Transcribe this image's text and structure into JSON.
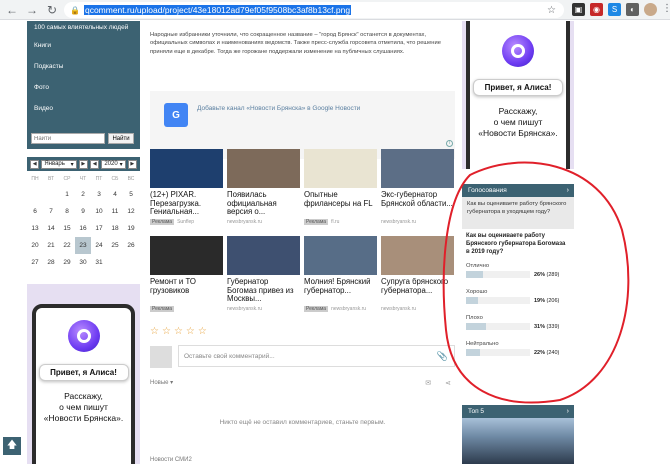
{
  "browser": {
    "url": "qcomment.ru/upload/project/43e18012ad79ef05f9508bc3af8b13cf.png"
  },
  "sidebar": {
    "items": [
      {
        "label": "100 самых влиятельных людей"
      },
      {
        "label": "Книги"
      },
      {
        "label": "Подкасты"
      },
      {
        "label": "Фото"
      },
      {
        "label": "Видео"
      }
    ],
    "search_placeholder": "Найти",
    "search_button": "Найти"
  },
  "calendar": {
    "month": "Январь",
    "year": "2020",
    "days_of_week": [
      "ПН",
      "ВТ",
      "СР",
      "ЧТ",
      "ПТ",
      "СБ",
      "ВС"
    ],
    "today": "23",
    "days": [
      "",
      "",
      "1",
      "2",
      "3",
      "4",
      "5",
      "6",
      "7",
      "8",
      "9",
      "10",
      "11",
      "12",
      "13",
      "14",
      "15",
      "16",
      "17",
      "18",
      "19",
      "20",
      "21",
      "22",
      "23",
      "24",
      "25",
      "26",
      "27",
      "28",
      "29",
      "30",
      "31",
      "",
      ""
    ]
  },
  "alice_ad": {
    "bubble": "Привет, я Алиса!",
    "text_line1": "Расскажу,",
    "text_line2": "о чем пишут",
    "text_line3": "«Новости Брянска»."
  },
  "article": {
    "text": "Народные избранники уточнили, что сокращенное название – \"город Брянск\" останется в документах, официальных символах и наименованиях ведомств. Также пресс-служба горсовета отметила, что решение приняли еще в декабре. Тогда же горожане поддержали изменение на публичных слушаниях."
  },
  "google_news": {
    "logo": "G",
    "text": "Добавьте канал «Новости Брянска» в Google Новости"
  },
  "ads": [
    {
      "title": "(12+) PIXAR. Перезагрузка. Гениальная...",
      "source": "Sunflep",
      "tag": "Реклама",
      "color": "#1e3f6e"
    },
    {
      "title": "Появилась официальная версия о...",
      "source": "newsbryansk.ru",
      "tag": "",
      "color": "#7d6a5a"
    },
    {
      "title": "Опытные фрилансеры на FL",
      "source": "fl.ru",
      "tag": "Реклама",
      "color": "#e9e4d2"
    },
    {
      "title": "Экс-губернатор Брянской области...",
      "source": "newsbryansk.ru",
      "tag": "",
      "color": "#5c6e86"
    },
    {
      "title": "Ремонт и ТО грузовиков",
      "source": "",
      "tag": "Реклама",
      "color": "#2a2a2a"
    },
    {
      "title": "Губернатор Богомаз привез из Москвы...",
      "source": "newsbryansk.ru",
      "tag": "",
      "color": "#3e5070"
    },
    {
      "title": "Молния! Брянский губернатор...",
      "source": "newsbryansk.ru",
      "tag": "Реклама",
      "color": "#576d87"
    },
    {
      "title": "Супруга брянского губернатора...",
      "source": "newsbryansk.ru",
      "tag": "",
      "color": "#a88f7a"
    }
  ],
  "comments": {
    "placeholder": "Оставьте свой комментарий...",
    "sort_label": "Новые ▾",
    "empty_text": "Никто ещё не оставил комментариев, станьте первым.",
    "bottom_label": "Новости СМИ2"
  },
  "poll": {
    "header": "Голосования",
    "previous_question": "Как вы оцениваете работу брянского губернатора в уходящем году?",
    "question": "Как вы оцениваете работу Брянского губернатора Богомаза в 2019 году?",
    "options": [
      {
        "label": "Отлично",
        "percent": "26%",
        "count": "(289)",
        "fraction": 0.26
      },
      {
        "label": "Хорошо",
        "percent": "19%",
        "count": "(206)",
        "fraction": 0.19
      },
      {
        "label": "Плохо",
        "percent": "31%",
        "count": "(339)",
        "fraction": 0.31
      },
      {
        "label": "Нейтрально",
        "percent": "22%",
        "count": "(240)",
        "fraction": 0.22
      }
    ]
  },
  "top5": {
    "header": "Топ 5"
  },
  "colors": {
    "sidebar_bg": "#3c6272",
    "annotation": "#e0202a",
    "ad_bg": "#e6dff2"
  }
}
